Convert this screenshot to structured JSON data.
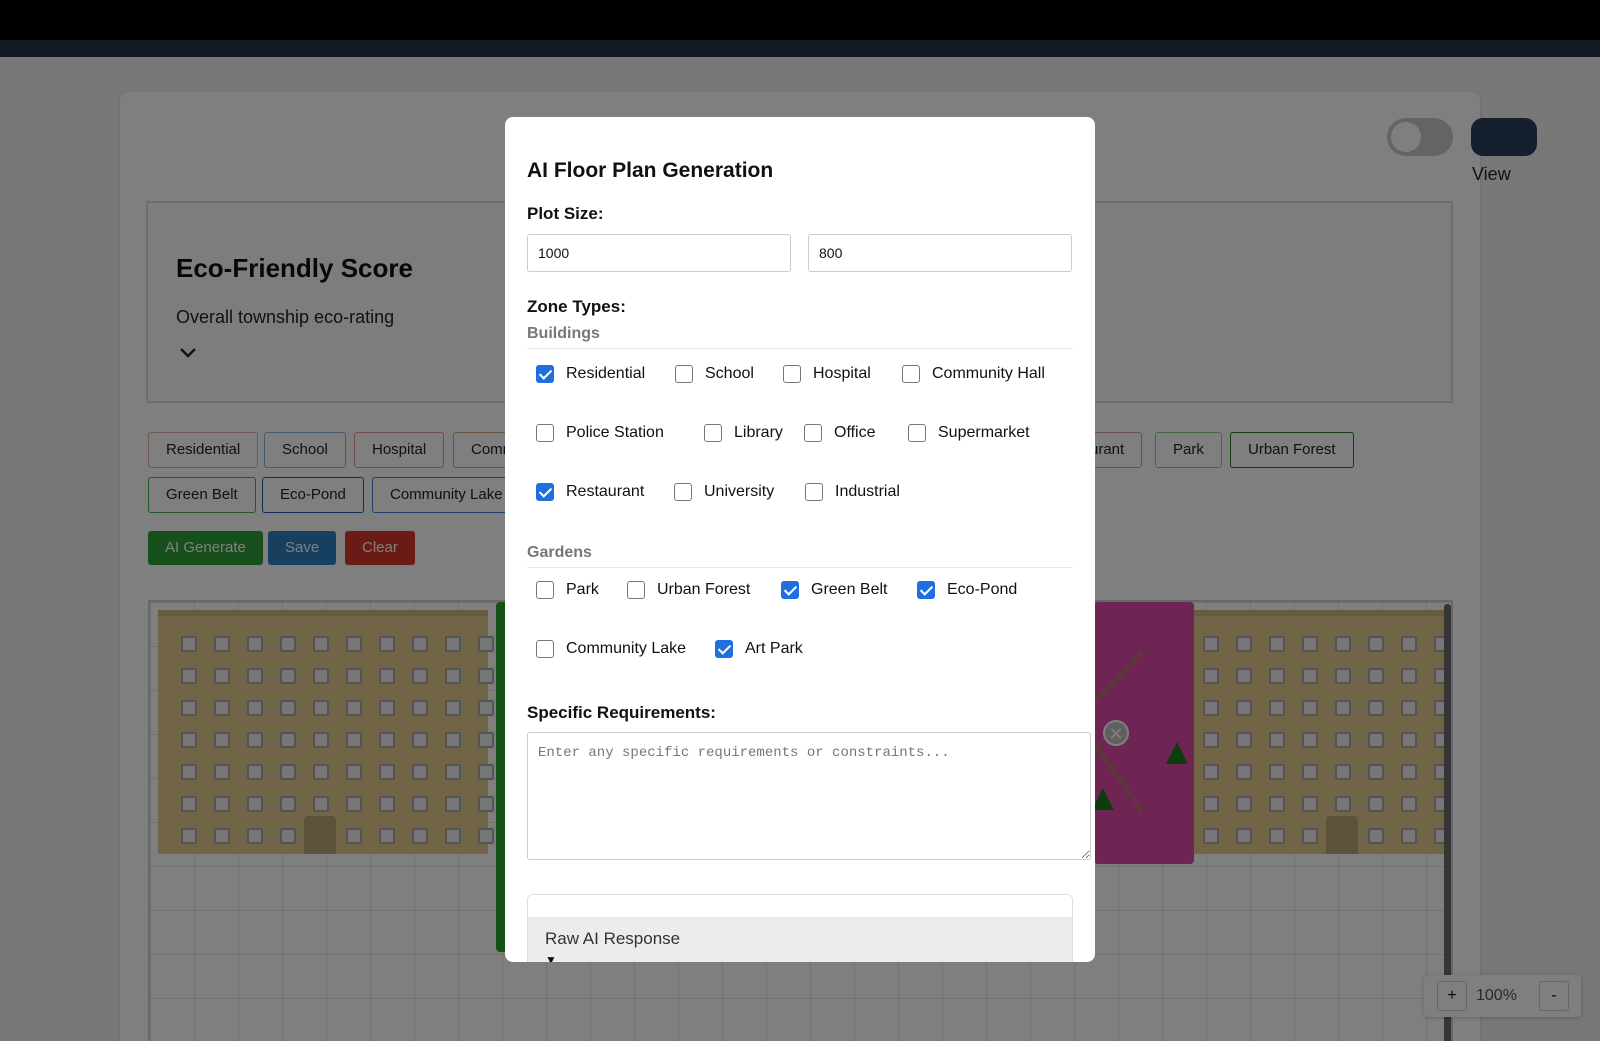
{
  "header": {
    "view_label": "View"
  },
  "score": {
    "title": "Eco-Friendly Score",
    "subtitle": "Overall township eco-rating"
  },
  "zone_chips": [
    {
      "label": "Residential",
      "color": "#e7b3a8"
    },
    {
      "label": "School",
      "color": "#8fb3d9"
    },
    {
      "label": "Hospital",
      "color": "#e39a9a"
    },
    {
      "label": "Comm",
      "color": "#cfa87a"
    },
    {
      "label": "urant",
      "color": "#e39a9a"
    },
    {
      "label": "Park",
      "color": "#8fd08f"
    },
    {
      "label": "Urban Forest",
      "color": "#2d7d2d"
    },
    {
      "label": "Green Belt",
      "color": "#4caf50"
    },
    {
      "label": "Eco-Pond",
      "color": "#1f5aa6"
    },
    {
      "label": "Community Lake",
      "color": "#3f7fc8"
    }
  ],
  "actions": {
    "ai_generate": "AI Generate",
    "save": "Save",
    "clear": "Clear",
    "colors": {
      "ai_generate": "#2e9e3a",
      "save": "#2f7fc1",
      "clear": "#d9342b"
    }
  },
  "zoom": {
    "plus": "+",
    "minus": "-",
    "level": "100%"
  },
  "modal": {
    "title": "AI Floor Plan Generation",
    "plot_size_label": "Plot Size:",
    "plot_width": "1000",
    "plot_height": "800",
    "zone_types_label": "Zone Types:",
    "buildings_label": "Buildings",
    "buildings": [
      {
        "label": "Residential",
        "checked": true
      },
      {
        "label": "School",
        "checked": false
      },
      {
        "label": "Hospital",
        "checked": false
      },
      {
        "label": "Community Hall",
        "checked": false
      },
      {
        "label": "Police Station",
        "checked": false
      },
      {
        "label": "Library",
        "checked": false
      },
      {
        "label": "Office",
        "checked": false
      },
      {
        "label": "Supermarket",
        "checked": false
      },
      {
        "label": "Restaurant",
        "checked": true
      },
      {
        "label": "University",
        "checked": false
      },
      {
        "label": "Industrial",
        "checked": false
      }
    ],
    "gardens_label": "Gardens",
    "gardens": [
      {
        "label": "Park",
        "checked": false
      },
      {
        "label": "Urban Forest",
        "checked": false
      },
      {
        "label": "Green Belt",
        "checked": true
      },
      {
        "label": "Eco-Pond",
        "checked": true
      },
      {
        "label": "Community Lake",
        "checked": false
      },
      {
        "label": "Art Park",
        "checked": true
      }
    ],
    "requirements_label": "Specific Requirements:",
    "requirements_placeholder": "Enter any specific requirements or constraints...",
    "requirements_value": "",
    "raw_response_label": "Raw AI Response"
  },
  "colors": {
    "accent": "#1f6fe0",
    "overlay": "rgba(0,0,0,0.5)"
  }
}
